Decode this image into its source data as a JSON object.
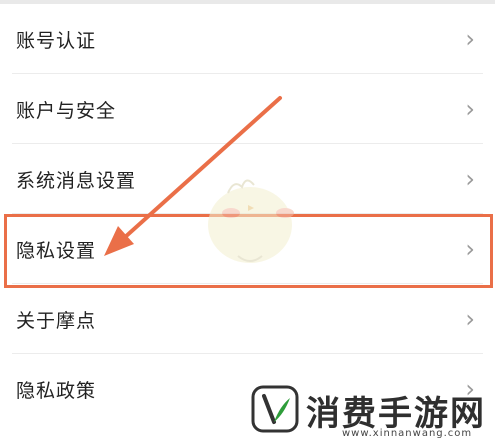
{
  "menu": {
    "items": [
      {
        "label": "账号认证"
      },
      {
        "label": "账户与安全"
      },
      {
        "label": "系统消息设置"
      },
      {
        "label": "隐私设置"
      },
      {
        "label": "关于摩点"
      },
      {
        "label": "隐私政策"
      }
    ],
    "chevron_icon": "chevron-right-icon"
  },
  "annotation": {
    "color": "#ea6f48",
    "highlighted_item": "隐私设置"
  },
  "watermark": {
    "title": "消费手游网",
    "url": "www.xinnanwang.com",
    "logo_icon": "leaf-k-logo-icon"
  }
}
